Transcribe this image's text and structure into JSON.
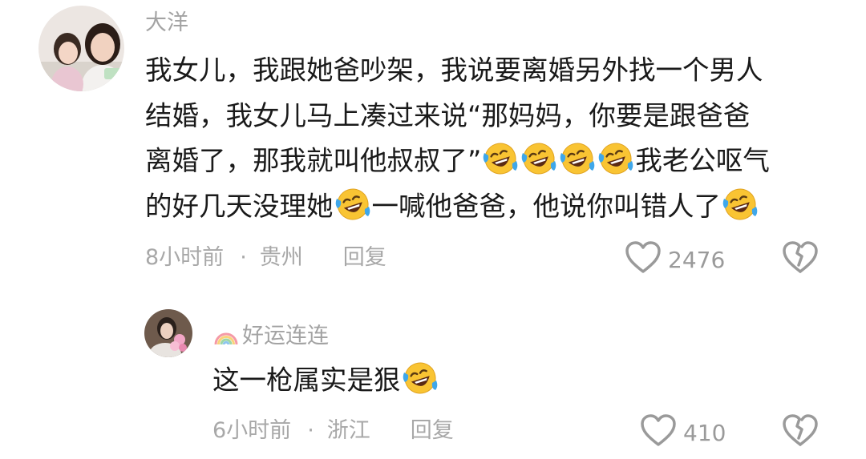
{
  "comments": [
    {
      "username": "大洋",
      "lines": [
        [
          {
            "t": "我女儿，我跟她爸吵架，我说要离婚另外找一个男人"
          }
        ],
        [
          {
            "t": "结婚，我女儿马上凑过来说“那妈妈，你要是跟爸爸"
          }
        ],
        [
          {
            "t": "离婚了，那我就叫他叔叔了”"
          },
          {
            "e": "laugh-cry-emoji"
          },
          {
            "e": "laugh-cry-emoji"
          },
          {
            "e": "laugh-cry-emoji"
          },
          {
            "e": "laugh-cry-emoji"
          },
          {
            "t": "我老公呕气"
          }
        ],
        [
          {
            "t": "的好几天没理她"
          },
          {
            "e": "laugh-cry-emoji"
          },
          {
            "t": "一喊他爸爸，他说你叫错人了"
          },
          {
            "e": "laugh-cry-emoji"
          }
        ]
      ],
      "time": "8小时前",
      "dot": "·",
      "location": "贵州",
      "reply_label": "回复",
      "like_count": "2476",
      "like_icon": "heart-outline-icon",
      "dislike_icon": "broken-heart-icon"
    },
    {
      "username": "好运连连",
      "username_prefix_icon": "rainbow-icon",
      "lines": [
        [
          {
            "t": "这一枪属实是狠"
          },
          {
            "e": "laugh-cry-emoji"
          }
        ]
      ],
      "time": "6小时前",
      "dot": "·",
      "location": "浙江",
      "reply_label": "回复",
      "like_count": "410",
      "like_icon": "heart-outline-icon",
      "dislike_icon": "broken-heart-icon"
    }
  ],
  "colors": {
    "text": "#1a1a1a",
    "muted": "#a3a3a3",
    "icon": "#9a9a9a",
    "emoji_face": "#f9c433"
  }
}
